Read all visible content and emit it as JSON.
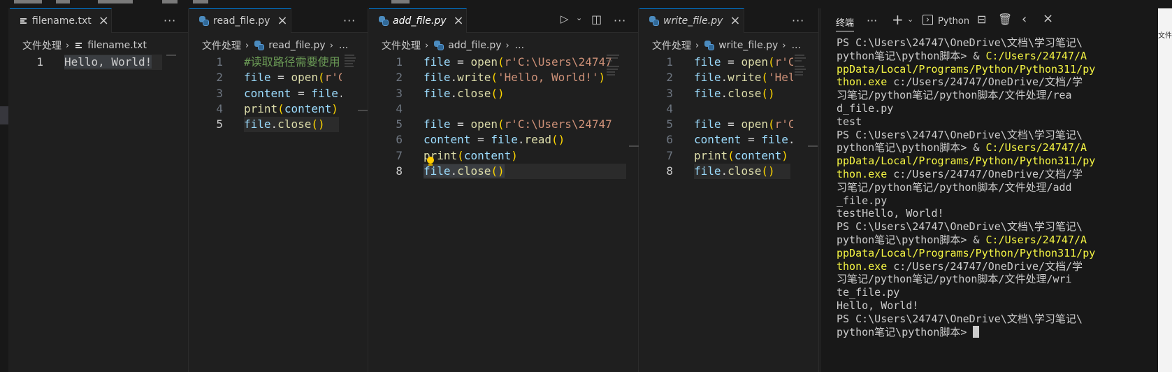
{
  "editor_groups": [
    {
      "tab": {
        "label": "filename.txt",
        "icon": "txt-file-icon"
      },
      "breadcrumb": {
        "folder": "文件处理",
        "file": "filename.txt"
      },
      "lines": [
        {
          "n": "1",
          "segments": [
            {
              "t": "Hello, World!",
              "c": "txt sel"
            }
          ]
        }
      ]
    },
    {
      "tab": {
        "label": "read_file.py",
        "icon": "python-icon"
      },
      "breadcrumb": {
        "folder": "文件处理",
        "file": "read_file.py",
        "more": "..."
      },
      "lines": [
        {
          "n": "1",
          "segments": [
            {
              "t": "#读取路径需要使用",
              "c": "cm"
            }
          ]
        },
        {
          "n": "2",
          "segments": [
            {
              "t": "file",
              "c": "var"
            },
            {
              "t": " = ",
              "c": "op"
            },
            {
              "t": "open",
              "c": "fn"
            },
            {
              "t": "(",
              "c": "br1"
            },
            {
              "t": "r'C",
              "c": "str"
            }
          ]
        },
        {
          "n": "3",
          "segments": [
            {
              "t": "content",
              "c": "var"
            },
            {
              "t": " = ",
              "c": "op"
            },
            {
              "t": "file",
              "c": "var"
            },
            {
              "t": ".r",
              "c": "op"
            }
          ]
        },
        {
          "n": "4",
          "segments": [
            {
              "t": "print",
              "c": "fn"
            },
            {
              "t": "(",
              "c": "br1"
            },
            {
              "t": "content",
              "c": "var"
            },
            {
              "t": ")",
              "c": "br1"
            }
          ]
        },
        {
          "n": "5",
          "segments": [
            {
              "t": "file",
              "c": "var"
            },
            {
              "t": ".",
              "c": "op"
            },
            {
              "t": "close",
              "c": "fn"
            },
            {
              "t": "()",
              "c": "br1"
            }
          ]
        }
      ]
    },
    {
      "tab": {
        "label": "add_file.py",
        "icon": "python-icon"
      },
      "breadcrumb": {
        "folder": "文件处理",
        "file": "add_file.py",
        "more": "..."
      },
      "lines": [
        {
          "n": "1",
          "segments": [
            {
              "t": "file",
              "c": "var"
            },
            {
              "t": " = ",
              "c": "op"
            },
            {
              "t": "open",
              "c": "fn"
            },
            {
              "t": "(",
              "c": "br1"
            },
            {
              "t": "r'C:\\Users\\24747",
              "c": "str"
            }
          ]
        },
        {
          "n": "2",
          "segments": [
            {
              "t": "file",
              "c": "var"
            },
            {
              "t": ".",
              "c": "op"
            },
            {
              "t": "write",
              "c": "fn"
            },
            {
              "t": "(",
              "c": "br1"
            },
            {
              "t": "'Hello, World!'",
              "c": "str"
            },
            {
              "t": ")",
              "c": "br1"
            }
          ]
        },
        {
          "n": "3",
          "segments": [
            {
              "t": "file",
              "c": "var"
            },
            {
              "t": ".",
              "c": "op"
            },
            {
              "t": "close",
              "c": "fn"
            },
            {
              "t": "()",
              "c": "br1"
            }
          ]
        },
        {
          "n": "4",
          "segments": []
        },
        {
          "n": "5",
          "segments": [
            {
              "t": "file",
              "c": "var"
            },
            {
              "t": " = ",
              "c": "op"
            },
            {
              "t": "open",
              "c": "fn"
            },
            {
              "t": "(",
              "c": "br1"
            },
            {
              "t": "r'C:\\Users\\24747",
              "c": "str"
            }
          ]
        },
        {
          "n": "6",
          "segments": [
            {
              "t": "content",
              "c": "var"
            },
            {
              "t": " = ",
              "c": "op"
            },
            {
              "t": "file",
              "c": "var"
            },
            {
              "t": ".",
              "c": "op"
            },
            {
              "t": "read",
              "c": "fn"
            },
            {
              "t": "()",
              "c": "br1"
            }
          ]
        },
        {
          "n": "7",
          "segments": [
            {
              "t": "print",
              "c": "fn"
            },
            {
              "t": "(",
              "c": "br1"
            },
            {
              "t": "content",
              "c": "var"
            },
            {
              "t": ")",
              "c": "br1"
            }
          ]
        },
        {
          "n": "8",
          "segments": [
            {
              "t": "file",
              "c": "var sel"
            },
            {
              "t": ".",
              "c": "op sel"
            },
            {
              "t": "close",
              "c": "fn sel"
            },
            {
              "t": "()",
              "c": "br1 sel"
            }
          ]
        }
      ]
    },
    {
      "tab": {
        "label": "write_file.py",
        "icon": "python-icon"
      },
      "breadcrumb": {
        "folder": "文件处理",
        "file": "write_file.py",
        "more": "..."
      },
      "lines": [
        {
          "n": "1",
          "segments": [
            {
              "t": "file",
              "c": "var"
            },
            {
              "t": " = ",
              "c": "op"
            },
            {
              "t": "open",
              "c": "fn"
            },
            {
              "t": "(",
              "c": "br1"
            },
            {
              "t": "r'C",
              "c": "str"
            }
          ]
        },
        {
          "n": "2",
          "segments": [
            {
              "t": "file",
              "c": "var"
            },
            {
              "t": ".",
              "c": "op"
            },
            {
              "t": "write",
              "c": "fn"
            },
            {
              "t": "(",
              "c": "br1"
            },
            {
              "t": "'Hell",
              "c": "str"
            }
          ]
        },
        {
          "n": "3",
          "segments": [
            {
              "t": "file",
              "c": "var"
            },
            {
              "t": ".",
              "c": "op"
            },
            {
              "t": "close",
              "c": "fn"
            },
            {
              "t": "()",
              "c": "br1"
            }
          ]
        },
        {
          "n": "4",
          "segments": []
        },
        {
          "n": "5",
          "segments": [
            {
              "t": "file",
              "c": "var"
            },
            {
              "t": " = ",
              "c": "op"
            },
            {
              "t": "open",
              "c": "fn"
            },
            {
              "t": "(",
              "c": "br1"
            },
            {
              "t": "r'C",
              "c": "str"
            }
          ]
        },
        {
          "n": "6",
          "segments": [
            {
              "t": "content",
              "c": "var"
            },
            {
              "t": " = ",
              "c": "op"
            },
            {
              "t": "file",
              "c": "var"
            },
            {
              "t": ".r",
              "c": "op"
            }
          ]
        },
        {
          "n": "7",
          "segments": [
            {
              "t": "print",
              "c": "fn"
            },
            {
              "t": "(",
              "c": "br1"
            },
            {
              "t": "content",
              "c": "var"
            },
            {
              "t": ")",
              "c": "br1"
            }
          ]
        },
        {
          "n": "8",
          "segments": [
            {
              "t": "file",
              "c": "var"
            },
            {
              "t": ".",
              "c": "op"
            },
            {
              "t": "close",
              "c": "fn"
            },
            {
              "t": "()",
              "c": "br1"
            }
          ]
        }
      ]
    }
  ],
  "terminal": {
    "title": "终端",
    "more": "···",
    "add": "+",
    "profile": "Python",
    "lines": [
      {
        "segments": [
          {
            "t": "PS C:\\Users\\24747\\OneDrive\\文档\\学习笔记\\",
            "y": false
          }
        ]
      },
      {
        "segments": [
          {
            "t": "python笔记\\python脚本> & ",
            "y": false
          },
          {
            "t": "C:/Users/24747/A",
            "y": true
          }
        ]
      },
      {
        "segments": [
          {
            "t": "ppData/Local/Programs/Python/Python311/py",
            "y": true
          }
        ]
      },
      {
        "segments": [
          {
            "t": "thon.exe",
            "y": true
          },
          {
            "t": " c:/Users/24747/OneDrive/文档/学",
            "y": false
          }
        ]
      },
      {
        "segments": [
          {
            "t": "习笔记/python笔记/python脚本/文件处理/rea",
            "y": false
          }
        ]
      },
      {
        "segments": [
          {
            "t": "d_file.py",
            "y": false
          }
        ]
      },
      {
        "segments": [
          {
            "t": "test",
            "y": false
          }
        ]
      },
      {
        "segments": [
          {
            "t": "PS C:\\Users\\24747\\OneDrive\\文档\\学习笔记\\",
            "y": false
          }
        ]
      },
      {
        "segments": [
          {
            "t": "python笔记\\python脚本> & ",
            "y": false
          },
          {
            "t": "C:/Users/24747/A",
            "y": true
          }
        ]
      },
      {
        "segments": [
          {
            "t": "ppData/Local/Programs/Python/Python311/py",
            "y": true
          }
        ]
      },
      {
        "segments": [
          {
            "t": "thon.exe",
            "y": true
          },
          {
            "t": " c:/Users/24747/OneDrive/文档/学",
            "y": false
          }
        ]
      },
      {
        "segments": [
          {
            "t": "习笔记/python笔记/python脚本/文件处理/add",
            "y": false
          }
        ]
      },
      {
        "segments": [
          {
            "t": "_file.py",
            "y": false
          }
        ]
      },
      {
        "segments": [
          {
            "t": "testHello, World!",
            "y": false
          }
        ]
      },
      {
        "segments": [
          {
            "t": "PS C:\\Users\\24747\\OneDrive\\文档\\学习笔记\\",
            "y": false
          }
        ]
      },
      {
        "segments": [
          {
            "t": "python笔记\\python脚本> & ",
            "y": false
          },
          {
            "t": "C:/Users/24747/A",
            "y": true
          }
        ]
      },
      {
        "segments": [
          {
            "t": "ppData/Local/Programs/Python/Python311/py",
            "y": true
          }
        ]
      },
      {
        "segments": [
          {
            "t": "thon.exe",
            "y": true
          },
          {
            "t": " c:/Users/24747/OneDrive/文档/学",
            "y": false
          }
        ]
      },
      {
        "segments": [
          {
            "t": "习笔记/python笔记/python脚本/文件处理/wri",
            "y": false
          }
        ]
      },
      {
        "segments": [
          {
            "t": "te_file.py",
            "y": false
          }
        ]
      },
      {
        "segments": [
          {
            "t": "Hello, World!",
            "y": false
          }
        ]
      },
      {
        "segments": [
          {
            "t": "PS C:\\Users\\24747\\OneDrive\\文档\\学习笔记\\",
            "y": false
          }
        ]
      },
      {
        "segments": [
          {
            "t": "python笔记\\python脚本> ",
            "y": false
          }
        ]
      }
    ]
  },
  "edge_text": "文件",
  "colors": {
    "accent": "#0078d4",
    "terminal_path": "#f5f543",
    "editor_bg": "#1f1f1f"
  }
}
